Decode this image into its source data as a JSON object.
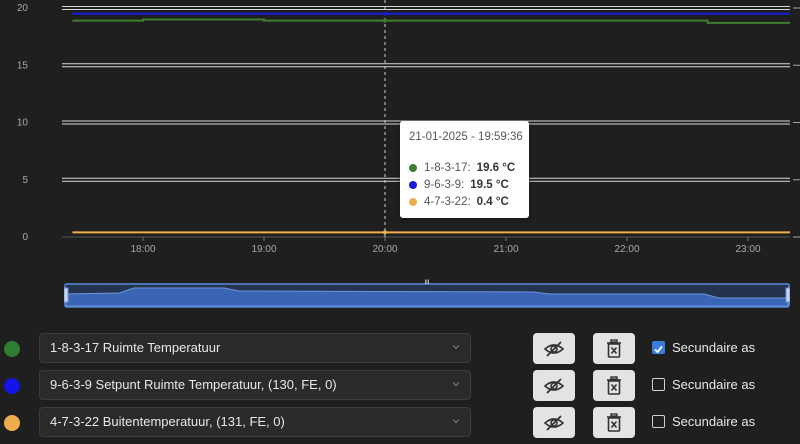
{
  "chart_data": {
    "type": "line",
    "x_ticks": [
      "18:00",
      "19:00",
      "20:00",
      "21:00",
      "22:00",
      "23:00"
    ],
    "y_ticks_left": [
      "0",
      "5",
      "10",
      "15",
      "20"
    ],
    "ylim": [
      0,
      20
    ],
    "grid": true,
    "series": [
      {
        "name": "1-8-3-17",
        "color": "#3d7f2f",
        "x": [
          "17:25",
          "18:00",
          "18:40",
          "19:00",
          "20:00",
          "21:00",
          "22:00",
          "22:40",
          "23:00",
          "23:20"
        ],
        "values": [
          18.9,
          19.0,
          19.0,
          18.9,
          18.9,
          18.9,
          18.9,
          18.7,
          18.7,
          18.7
        ]
      },
      {
        "name": "9-6-3-9",
        "color": "#1a1adb",
        "x": [
          "17:25",
          "23:20"
        ],
        "values": [
          19.5,
          19.5
        ]
      },
      {
        "name": "4-7-3-22",
        "color": "#f0ad4e",
        "x": [
          "17:25",
          "23:20"
        ],
        "values": [
          0.4,
          0.4
        ]
      }
    ]
  },
  "tooltip": {
    "title": "21-01-2025 - 19:59:36",
    "rows": [
      {
        "name": "1-8-3-17:",
        "value": "19.6 °C",
        "color": "#3d7f2f"
      },
      {
        "name": "9-6-3-9:",
        "value": "19.5 °C",
        "color": "#1a1adb"
      },
      {
        "name": "4-7-3-22:",
        "value": "0.4 °C",
        "color": "#f0ad4e"
      }
    ]
  },
  "navigator": {
    "handle_label": "III"
  },
  "series_rows": [
    {
      "color": "#2e7d32",
      "label": "1-8-3-17 Ruimte Temperatuur",
      "secondary_checked": true,
      "secondary_label": "Secundaire as"
    },
    {
      "color": "#1414e6",
      "label": "9-6-3-9 Setpunt Ruimte Temperatuur, (130, FE, 0)",
      "secondary_checked": false,
      "secondary_label": "Secundaire as"
    },
    {
      "color": "#f0ad4e",
      "label": "4-7-3-22 Buitentemperatuur, (131, FE, 0)",
      "secondary_checked": false,
      "secondary_label": "Secundaire as"
    }
  ],
  "icons": {
    "hide": "eye-slash-icon",
    "delete": "trash-x-icon",
    "dropdown": "chevron-down-icon"
  }
}
